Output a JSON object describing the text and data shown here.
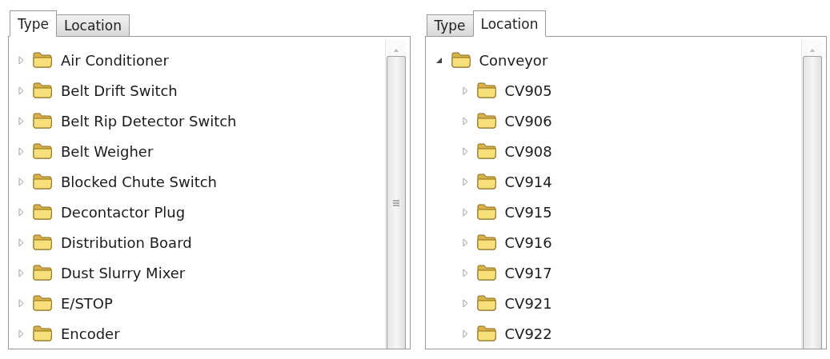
{
  "panes": [
    {
      "tabs": [
        {
          "label": "Type",
          "selected": true
        },
        {
          "label": "Location",
          "selected": false
        }
      ],
      "tree": [
        {
          "label": "Air Conditioner",
          "expanded": false
        },
        {
          "label": "Belt Drift Switch",
          "expanded": false
        },
        {
          "label": "Belt Rip Detector Switch",
          "expanded": false
        },
        {
          "label": "Belt Weigher",
          "expanded": false
        },
        {
          "label": "Blocked Chute Switch",
          "expanded": false
        },
        {
          "label": "Decontactor Plug",
          "expanded": false
        },
        {
          "label": "Distribution Board",
          "expanded": false
        },
        {
          "label": "Dust Slurry Mixer",
          "expanded": false
        },
        {
          "label": "E/STOP",
          "expanded": false
        },
        {
          "label": "Encoder",
          "expanded": false
        }
      ]
    },
    {
      "tabs": [
        {
          "label": "Type",
          "selected": false
        },
        {
          "label": "Location",
          "selected": true
        }
      ],
      "tree": [
        {
          "label": "Conveyor",
          "expanded": true,
          "children": [
            {
              "label": "CV905",
              "expanded": false
            },
            {
              "label": "CV906",
              "expanded": false
            },
            {
              "label": "CV908",
              "expanded": false
            },
            {
              "label": "CV914",
              "expanded": false
            },
            {
              "label": "CV915",
              "expanded": false
            },
            {
              "label": "CV916",
              "expanded": false
            },
            {
              "label": "CV917",
              "expanded": false
            },
            {
              "label": "CV921",
              "expanded": false
            },
            {
              "label": "CV922",
              "expanded": false
            }
          ]
        }
      ]
    }
  ]
}
